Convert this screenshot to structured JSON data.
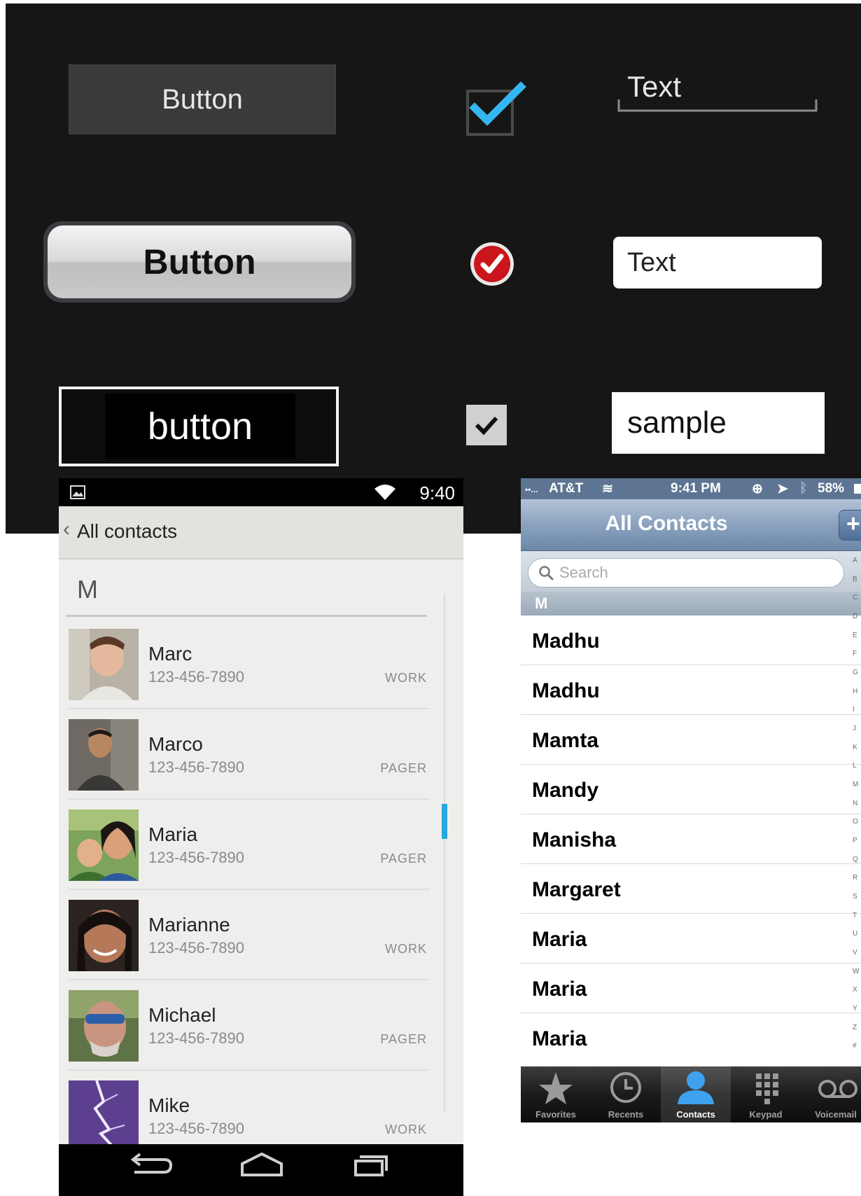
{
  "widgets": {
    "holo": {
      "button_label": "Button",
      "text_value": "Text"
    },
    "ios": {
      "button_label": "Button",
      "text_value": "Text"
    },
    "win": {
      "button_label": "button",
      "text_value": "sample"
    }
  },
  "android": {
    "status": {
      "time": "9:40"
    },
    "header": {
      "title": "All contacts"
    },
    "section": "M",
    "contacts": [
      {
        "name": "Marc",
        "phone": "123-456-7890",
        "type": "WORK"
      },
      {
        "name": "Marco",
        "phone": "123-456-7890",
        "type": "PAGER"
      },
      {
        "name": "Maria",
        "phone": "123-456-7890",
        "type": "PAGER"
      },
      {
        "name": "Marianne",
        "phone": "123-456-7890",
        "type": "WORK"
      },
      {
        "name": "Michael",
        "phone": "123-456-7890",
        "type": "PAGER"
      },
      {
        "name": "Mike",
        "phone": "123-456-7890",
        "type": "WORK"
      }
    ],
    "accent": "#29a7e1"
  },
  "ios": {
    "status": {
      "carrier": "AT&T",
      "time": "9:41 PM",
      "battery": "58%"
    },
    "nav": {
      "title": "All Contacts",
      "add_label": "+"
    },
    "search": {
      "placeholder": "Search"
    },
    "section": "M",
    "contacts": [
      "Madhu",
      "Madhu",
      "Mamta",
      "Mandy",
      "Manisha",
      "Margaret",
      "Maria",
      "Maria",
      "Maria"
    ],
    "index_letters": [
      "A",
      "B",
      "C",
      "D",
      "E",
      "F",
      "G",
      "H",
      "I",
      "J",
      "K",
      "L",
      "M",
      "N",
      "O",
      "P",
      "Q",
      "R",
      "S",
      "T",
      "U",
      "V",
      "W",
      "X",
      "Y",
      "Z",
      "#"
    ],
    "tabs": [
      {
        "label": "Favorites",
        "icon": "star-icon"
      },
      {
        "label": "Recents",
        "icon": "clock-icon"
      },
      {
        "label": "Contacts",
        "icon": "person-icon",
        "active": true
      },
      {
        "label": "Keypad",
        "icon": "keypad-icon"
      },
      {
        "label": "Voicemail",
        "icon": "voicemail-icon"
      }
    ]
  }
}
